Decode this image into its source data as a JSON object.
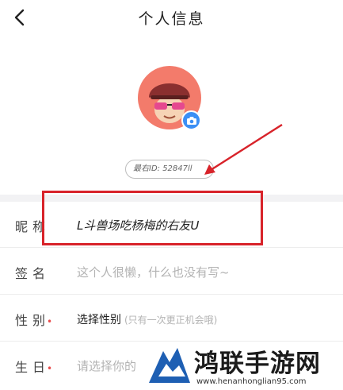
{
  "header": {
    "title": "个人信息",
    "back_icon": "chevron-left-icon"
  },
  "profile": {
    "avatar_icon": "mushroom-avatar",
    "camera_icon": "camera-icon",
    "id_text": "最右ID: 52847ll"
  },
  "fields": [
    {
      "label": "昵称",
      "value": "L斗兽场吃杨梅的右友U",
      "required": false,
      "placeholder": false
    },
    {
      "label": "签名",
      "value": "这个人很懒，什么也没有写~",
      "required": false,
      "placeholder": true
    },
    {
      "label": "性别",
      "value": "选择性别",
      "hint": "(只有一次更正机会哦)",
      "required": true,
      "placeholder": false
    },
    {
      "label": "生日",
      "value": "请选择你的",
      "required": true,
      "placeholder": true
    }
  ],
  "watermark": {
    "text": "鸿联手游网",
    "url": "www.henanhonglian95.com"
  },
  "colors": {
    "accent": "#3b8ff5",
    "annotation": "#d8232a",
    "required": "#e84c4c"
  }
}
